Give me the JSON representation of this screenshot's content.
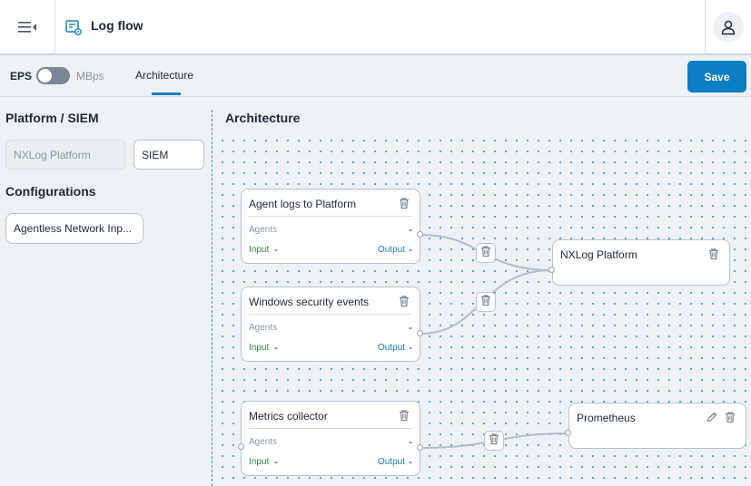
{
  "header": {
    "menu_icon": "menu-collapse-icon",
    "title_icon": "log-flow-icon",
    "title": "Log flow",
    "user_icon": "user-icon"
  },
  "subbar": {
    "eps_label": "EPS",
    "mbps_label": "MBps",
    "tab_label": "Architecture",
    "save_label": "Save"
  },
  "left": {
    "platform_title": "Platform / SIEM",
    "platform_value": "NXLog Platform",
    "siem_value": "SIEM",
    "config_title": "Configurations",
    "config_item": "Agentless Network Inp..."
  },
  "canvas": {
    "title": "Architecture",
    "nodes": [
      {
        "name": "Agent logs to Platform",
        "agents_label": "Agents",
        "agents_value": "-",
        "input_label": "Input",
        "input_value": "-",
        "output_label": "Output",
        "output_value": "-"
      },
      {
        "name": "Windows security events",
        "agents_label": "Agents",
        "agents_value": "-",
        "input_label": "Input",
        "input_value": "-",
        "output_label": "Output",
        "output_value": "-"
      },
      {
        "name": "Metrics collector",
        "agents_label": "Agents",
        "agents_value": "-",
        "input_label": "Input",
        "input_value": "-",
        "output_label": "Output",
        "output_value": "-"
      }
    ],
    "destinations": [
      {
        "name": "NXLog Platform"
      },
      {
        "name": "Prometheus"
      }
    ]
  },
  "colors": {
    "accent": "#0c7ec3",
    "input_green": "#2f8a3a",
    "output_blue": "#1a7fc1",
    "dot_grid": "#3f9dd9"
  }
}
